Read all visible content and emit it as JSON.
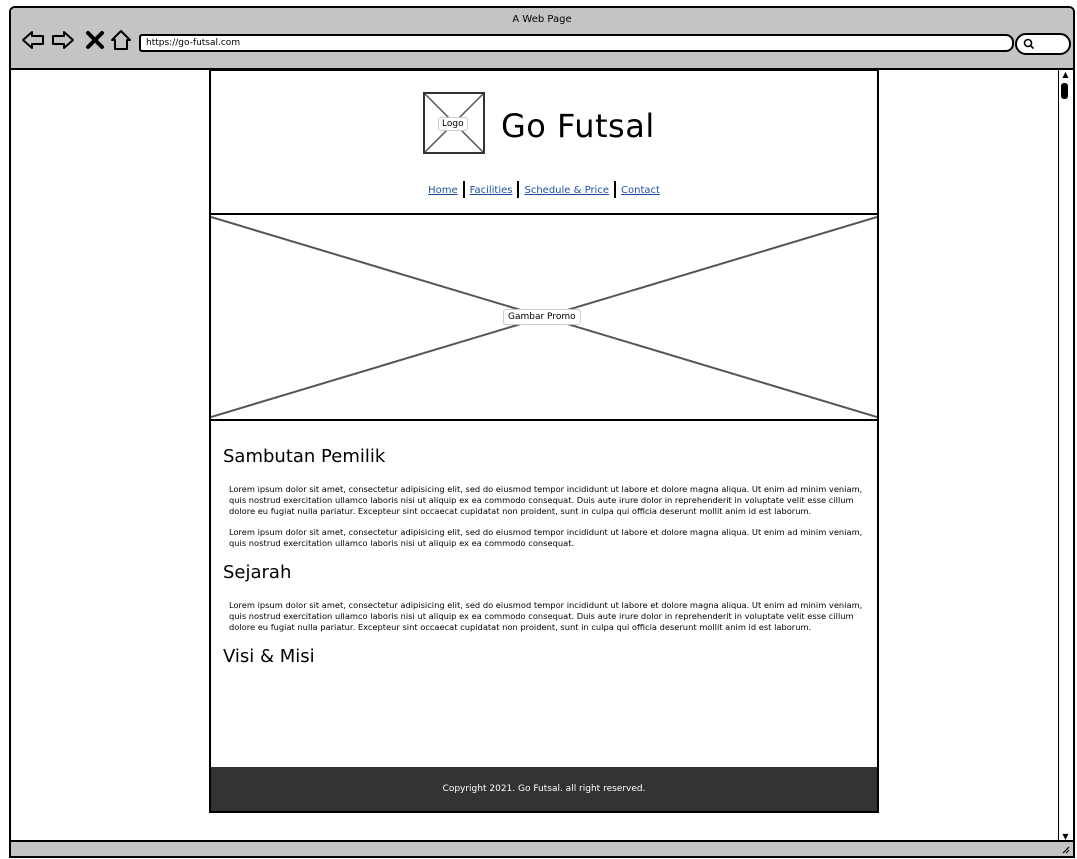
{
  "browser": {
    "title": "A Web Page",
    "url": "https://go-futsal.com"
  },
  "header": {
    "logo_label": "Logo",
    "site_title": "Go Futsal",
    "nav": [
      "Home",
      "Facilities",
      "Schedule & Price",
      "Contact"
    ]
  },
  "promo": {
    "label": "Gambar Promo"
  },
  "sections": {
    "sambutan": {
      "heading": "Sambutan Pemilik",
      "p1": "Lorem ipsum dolor sit amet, consectetur adipisicing elit, sed do eiusmod tempor incididunt ut labore et dolore magna aliqua. Ut enim ad minim veniam, quis nostrud exercitation ullamco laboris nisi ut aliquip ex ea commodo consequat. Duis aute irure dolor in reprehenderit in voluptate velit esse cillum dolore eu fugiat nulla pariatur. Excepteur sint occaecat cupidatat non proident, sunt in culpa qui officia deserunt mollit anim id est laborum.",
      "p2": "Lorem ipsum dolor sit amet, consectetur adipisicing elit, sed do eiusmod tempor incididunt ut labore et dolore magna aliqua. Ut enim ad minim veniam, quis nostrud exercitation ullamco laboris nisi ut aliquip ex ea commodo consequat."
    },
    "sejarah": {
      "heading": "Sejarah",
      "p1": "Lorem ipsum dolor sit amet, consectetur adipisicing elit, sed do eiusmod tempor incididunt ut labore et dolore magna aliqua. Ut enim ad minim veniam, quis nostrud exercitation ullamco laboris nisi ut aliquip ex ea commodo consequat. Duis aute irure dolor in reprehenderit in voluptate velit esse cillum dolore eu fugiat nulla pariatur. Excepteur sint occaecat cupidatat non proident, sunt in culpa qui officia deserunt mollit anim id est laborum."
    },
    "visi": {
      "heading": "Visi & Misi"
    }
  },
  "footer": {
    "text": "Copyright 2021. Go Futsal. all right reserved."
  },
  "icons": [
    "back-arrow-icon",
    "forward-arrow-icon",
    "close-icon",
    "home-icon",
    "search-icon",
    "scroll-up-icon",
    "scroll-down-icon",
    "resize-handle-icon"
  ],
  "colors": {
    "link": "#1a4f9c",
    "footer_bg": "#333333",
    "chrome": "#c4c4c4"
  }
}
